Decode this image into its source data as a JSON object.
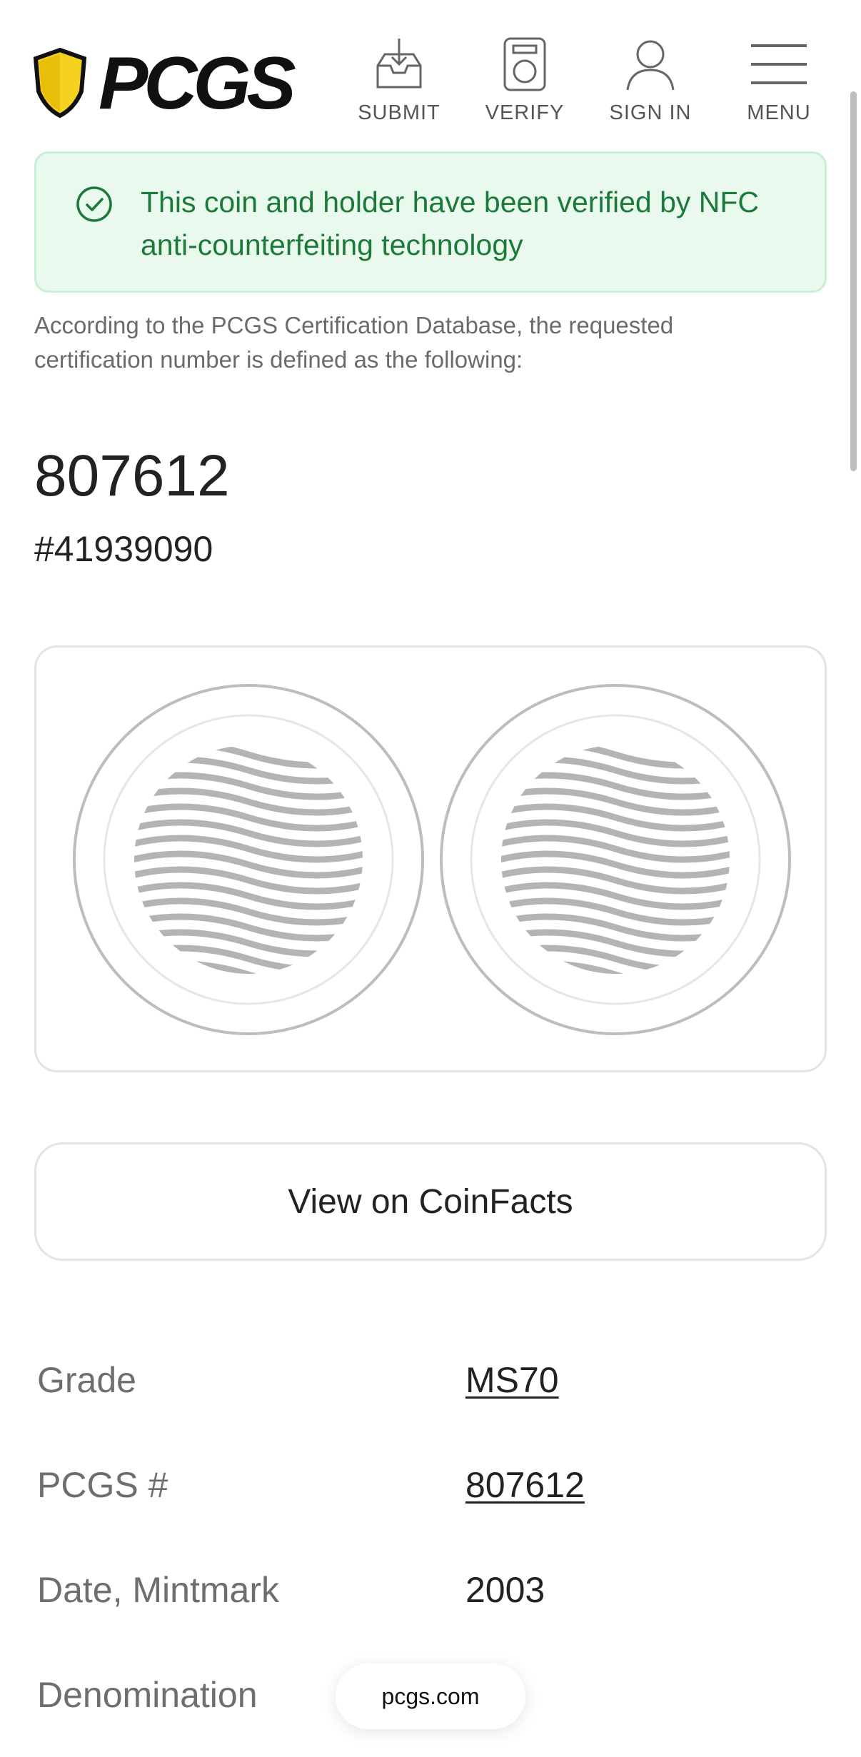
{
  "header": {
    "logo_text": "PCGS",
    "nav": [
      {
        "label": "SUBMIT",
        "icon": "inbox-download-icon"
      },
      {
        "label": "VERIFY",
        "icon": "holder-icon"
      },
      {
        "label": "SIGN IN",
        "icon": "user-icon"
      },
      {
        "label": "MENU",
        "icon": "hamburger-menu-icon"
      }
    ]
  },
  "alert": {
    "text": "This coin and holder have been verified by NFC anti-counterfeiting technology",
    "icon": "check-circle-icon",
    "color": "#1b7a3a"
  },
  "intro": "According to the PCGS Certification Database, the requested certification number is defined as the following:",
  "cert": {
    "title": "807612",
    "number": "#41939090"
  },
  "images": {
    "placeholder_icon": "coin-placeholder-icon"
  },
  "coinfacts_button": "View on CoinFacts",
  "details": [
    {
      "label": "Grade",
      "value": "MS70",
      "link": true
    },
    {
      "label": "PCGS #",
      "value": "807612",
      "link": true
    },
    {
      "label": "Date, Mintmark",
      "value": "2003",
      "link": false
    },
    {
      "label": "Denomination",
      "value": "",
      "link": false
    }
  ],
  "browser": {
    "url": "pcgs.com"
  }
}
